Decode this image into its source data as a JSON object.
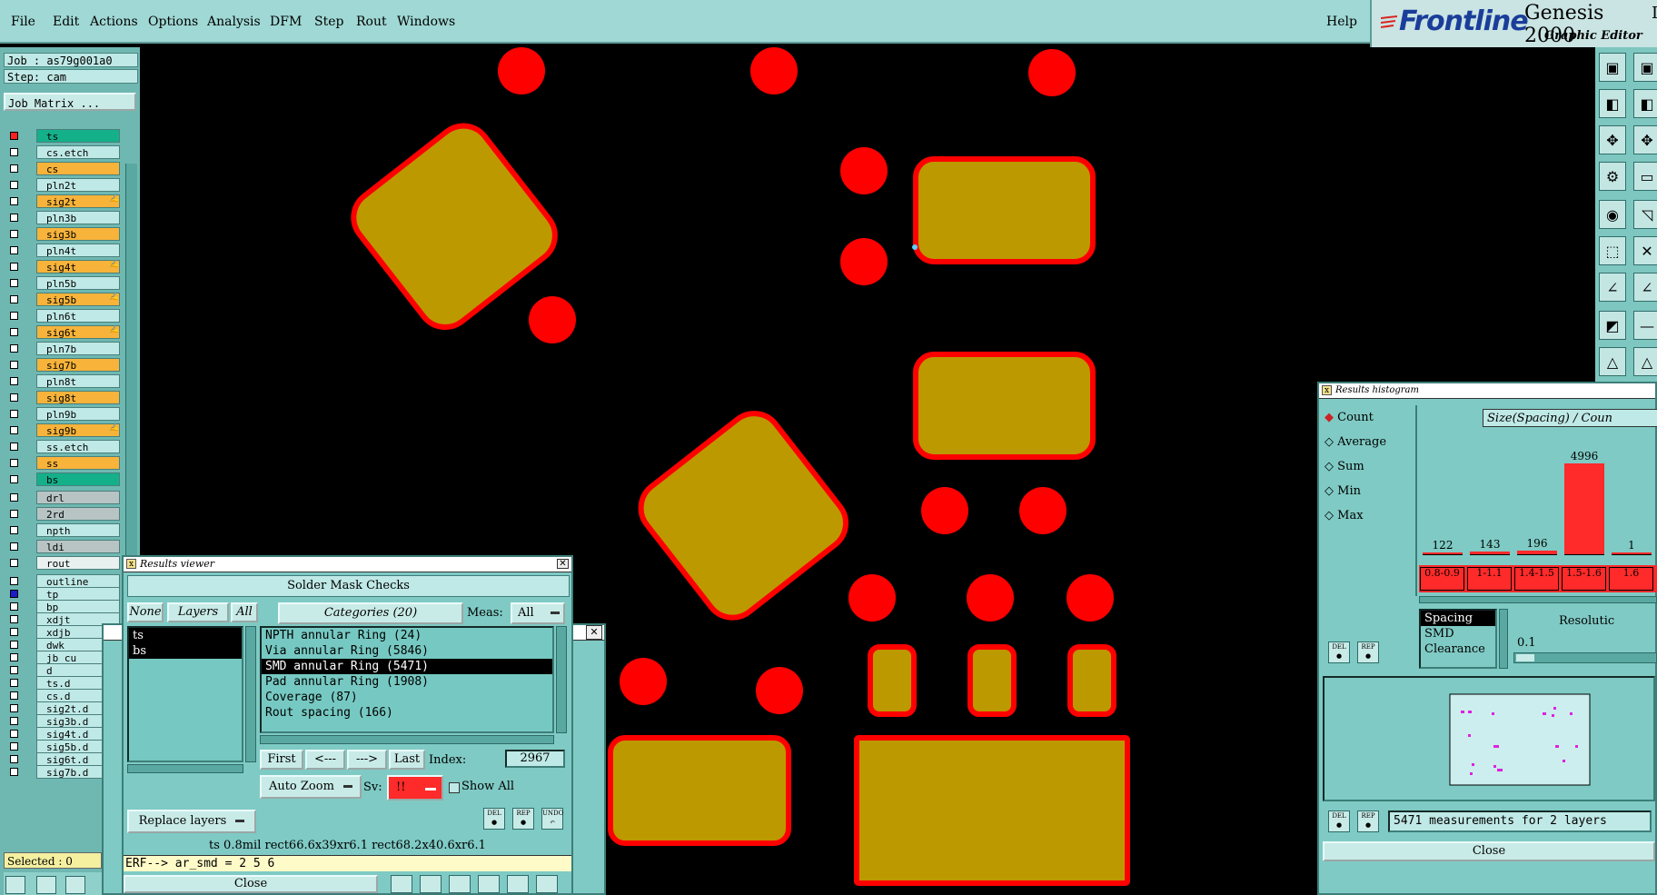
{
  "menu": [
    "File",
    "Edit",
    "Actions",
    "Options",
    "Analysis",
    "DFM",
    "Step",
    "Rout",
    "Windows"
  ],
  "help": "Help",
  "logo": {
    "brand": "Frontline",
    "product": "Genesis 2000",
    "suffix": "Graphic Editor",
    "version_fragment": "I"
  },
  "job": {
    "job_line": "Job : as79g001a0",
    "step_line": "Step: cam",
    "matrix_button": "Job Matrix ..."
  },
  "layers": [
    {
      "name": "ts",
      "color": "teal",
      "box": "red"
    },
    {
      "name": "cs.etch",
      "color": "cyan"
    },
    {
      "name": "cs",
      "color": "orange"
    },
    {
      "name": "pln2t",
      "color": "cyan"
    },
    {
      "name": "sig2t",
      "color": "orange",
      "flag": "✍"
    },
    {
      "name": "pln3b",
      "color": "cyan"
    },
    {
      "name": "sig3b",
      "color": "orange"
    },
    {
      "name": "pln4t",
      "color": "cyan"
    },
    {
      "name": "sig4t",
      "color": "orange",
      "flag": "✍"
    },
    {
      "name": "pln5b",
      "color": "cyan"
    },
    {
      "name": "sig5b",
      "color": "orange",
      "flag": "✍"
    },
    {
      "name": "pln6t",
      "color": "cyan"
    },
    {
      "name": "sig6t",
      "color": "orange",
      "flag": "✍"
    },
    {
      "name": "pln7b",
      "color": "cyan"
    },
    {
      "name": "sig7b",
      "color": "orange"
    },
    {
      "name": "pln8t",
      "color": "cyan"
    },
    {
      "name": "sig8t",
      "color": "orange"
    },
    {
      "name": "pln9b",
      "color": "cyan"
    },
    {
      "name": "sig9b",
      "color": "orange",
      "flag": "✍"
    },
    {
      "name": "ss.etch",
      "color": "cyan"
    },
    {
      "name": "ss",
      "color": "orange"
    },
    {
      "name": "bs",
      "color": "teal"
    },
    {
      "name": "drl",
      "color": "gray"
    },
    {
      "name": "2rd",
      "color": "gray"
    },
    {
      "name": "npth",
      "color": "cyan"
    },
    {
      "name": "ldi",
      "color": "gray"
    },
    {
      "name": "rout",
      "color": "white"
    },
    {
      "name": "outline",
      "color": "cyan"
    },
    {
      "name": "tp",
      "color": "cyan",
      "box": "blue"
    },
    {
      "name": "bp",
      "color": "cyan"
    },
    {
      "name": "xdjt",
      "color": "cyan"
    },
    {
      "name": "xdjb",
      "color": "cyan"
    },
    {
      "name": "dwk",
      "color": "cyan"
    },
    {
      "name": "jb_cu",
      "color": "cyan"
    },
    {
      "name": "d",
      "color": "cyan"
    },
    {
      "name": "ts.d",
      "color": "cyan"
    },
    {
      "name": "cs.d",
      "color": "cyan"
    },
    {
      "name": "sig2t.d",
      "color": "cyan"
    },
    {
      "name": "sig3b.d",
      "color": "cyan"
    },
    {
      "name": "sig4t.d",
      "color": "cyan"
    },
    {
      "name": "sig5b.d",
      "color": "cyan"
    },
    {
      "name": "sig6t.d",
      "color": "cyan"
    },
    {
      "name": "sig7b.d",
      "color": "cyan"
    }
  ],
  "selected": "Selected : 0",
  "results_viewer": {
    "title": "Results viewer",
    "header": "Solder Mask Checks",
    "none_btn": "None",
    "layers_btn": "Layers",
    "all_btn": "All",
    "categories_btn": "Categories (20)",
    "meas_label": "Meas:",
    "meas_value": "All",
    "layer_list": [
      "ts",
      "bs"
    ],
    "categories": [
      "NPTH annular Ring (24)",
      "Via annular Ring (5846)",
      "SMD annular Ring (5471)",
      "Pad annular Ring (1908)",
      "Coverage (87)",
      "Rout spacing (166)"
    ],
    "selected_category": "SMD annular Ring (5471)",
    "first": "First",
    "prev": "<---",
    "next": "--->",
    "last": "Last",
    "index_label": "Index:",
    "index_value": "2967",
    "auto_zoom": "Auto Zoom",
    "sv_label": "Sv:",
    "sv_value": "!!",
    "show_all": "Show All",
    "replace_layers": "Replace layers",
    "info_line": "ts 0.8mil  rect66.6x39xr6.1  rect68.2x40.6xr6.1",
    "erf_line": "ERF--> ar_smd = 2 5 6",
    "close": "Close",
    "icons": [
      "DEL",
      "REP",
      "UNDO"
    ]
  },
  "histogram": {
    "title": "Results histogram",
    "modes": [
      "Count",
      "Average",
      "Sum",
      "Min",
      "Max"
    ],
    "selected_mode": "Count",
    "chart_title": "Size(Spacing) / Coun",
    "counts": [
      "122",
      "143",
      "196",
      "4996",
      "1"
    ],
    "bins": [
      "0.8-0.9",
      "1-1.1",
      "1.4-1.5",
      "1.5-1.6",
      "1.6"
    ],
    "measures": [
      "Spacing",
      "SMD",
      "Clearance"
    ],
    "resolution_label": "Resolutic",
    "resolution_value": "0.1",
    "status": "5471 measurements for 2 layers",
    "close": "Close",
    "icons": [
      "DEL",
      "REP"
    ]
  }
}
